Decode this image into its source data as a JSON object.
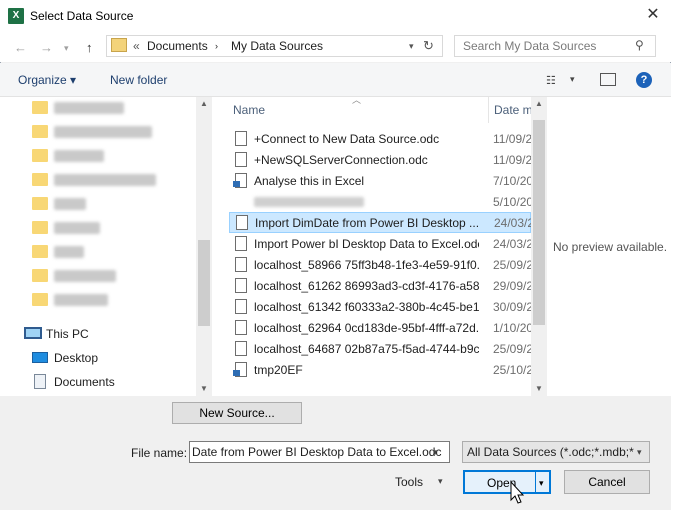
{
  "window": {
    "title": "Select Data Source"
  },
  "address": {
    "back_sep": "«",
    "segments": [
      "Documents",
      "My Data Sources"
    ]
  },
  "search": {
    "placeholder": "Search My Data Sources"
  },
  "toolbar": {
    "organize": "Organize ▾",
    "new_folder": "New folder"
  },
  "nav_tree": {
    "this_pc": "This PC",
    "desktop": "Desktop",
    "documents": "Documents"
  },
  "columns": {
    "name": "Name",
    "date": "Date m"
  },
  "files": [
    {
      "name": "+Connect to New Data Source.odc",
      "date": "11/09/2"
    },
    {
      "name": "+NewSQLServerConnection.odc",
      "date": "11/09/2"
    },
    {
      "name": "Analyse this in Excel",
      "date": "7/10/20"
    },
    {
      "name": "",
      "date": "5/10/20"
    },
    {
      "name": "Import DimDate from Power BI Desktop ...",
      "date": "24/03/2"
    },
    {
      "name": "Import Power bI Desktop Data to Excel.odc",
      "date": "24/03/2"
    },
    {
      "name": "localhost_58966 75ff3b48-1fe3-4e59-91f0...",
      "date": "25/09/2"
    },
    {
      "name": "localhost_61262 86993ad3-cd3f-4176-a58...",
      "date": "29/09/2"
    },
    {
      "name": "localhost_61342 f60333a2-380b-4c45-be1...",
      "date": "30/09/2"
    },
    {
      "name": "localhost_62964 0cd183de-95bf-4fff-a72d...",
      "date": "1/10/20"
    },
    {
      "name": "localhost_64687 02b87a75-f5ad-4744-b9c...",
      "date": "25/09/2"
    },
    {
      "name": "tmp20EF",
      "date": "25/10/2"
    }
  ],
  "preview": {
    "text": "No preview available."
  },
  "buttons": {
    "new_source": "New Source...",
    "tools": "Tools",
    "open": "Open",
    "cancel": "Cancel"
  },
  "file_name": {
    "label": "File name:",
    "value": "Date from Power BI Desktop Data to Excel.odc"
  },
  "filter": {
    "value": "All Data Sources (*.odc;*.mdb;*"
  }
}
